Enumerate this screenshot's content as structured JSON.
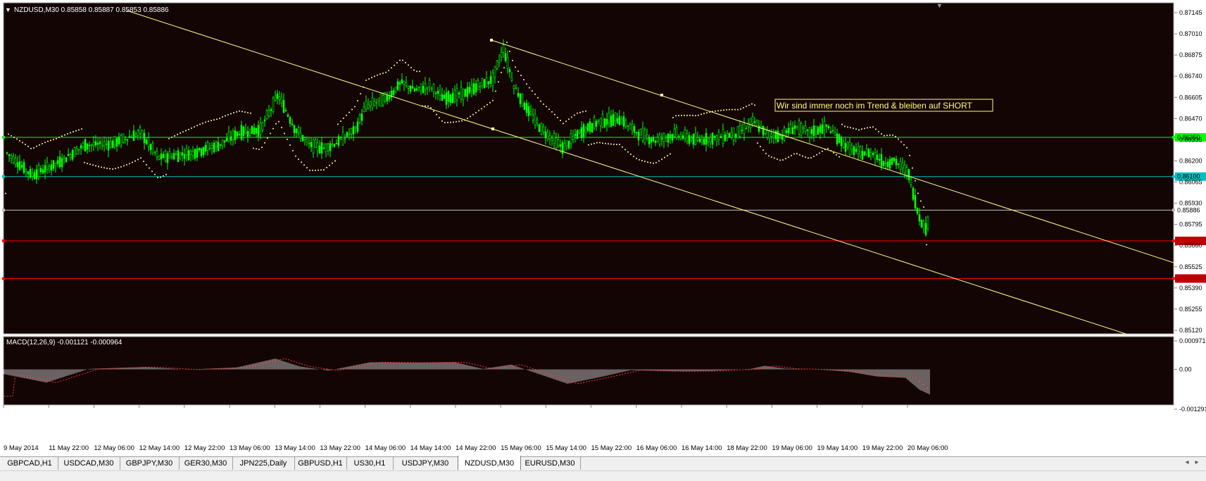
{
  "chart": {
    "header": "NZDUSD,M30  0.85858 0.85887 0.85853 0.85886",
    "annotation_text": "Wir sind immer noch im Trend &  bleiben auf SHORT",
    "macd_header": "MACD(12,26,9) -0.001121 -0.000964"
  },
  "chart_data": [
    {
      "type": "line",
      "title": "NZDUSD,M30",
      "ohlc": [
        0.85858,
        0.85887,
        0.85853,
        0.85886
      ],
      "y_ticks": [
        "0.87145",
        "0.87010",
        "0.86875",
        "0.86740",
        "0.86605",
        "0.86470",
        "0.86335",
        "0.86200",
        "0.86065",
        "0.85930",
        "0.85795",
        "0.85660",
        "0.85525",
        "0.85390",
        "0.85255",
        "0.85120"
      ],
      "ylim": [
        0.8512,
        0.87145
      ],
      "x_ticks": [
        "9 May 2014",
        "11 May 22:00",
        "12 May 06:00",
        "12 May 14:00",
        "12 May 22:00",
        "13 May 06:00",
        "13 May 14:00",
        "13 May 22:00",
        "14 May 06:00",
        "14 May 14:00",
        "14 May 22:00",
        "15 May 06:00",
        "15 May 14:00",
        "15 May 22:00",
        "16 May 06:00",
        "16 May 14:00",
        "18 May 22:00",
        "19 May 06:00",
        "19 May 14:00",
        "19 May 22:00",
        "20 May 06:00"
      ],
      "horizontal_levels": [
        {
          "label": "0.86350",
          "value": 0.8635,
          "color": "#00ff00"
        },
        {
          "label": "0.86100",
          "value": 0.861,
          "color": "#00c0c0"
        },
        {
          "label": "0.85886",
          "value": 0.85886,
          "color": "#c0c0c0"
        },
        {
          "label": "",
          "value": 0.8569,
          "color": "#ff0000"
        },
        {
          "label": "",
          "value": 0.8545,
          "color": "#ff0000"
        }
      ],
      "trend_channel": [
        {
          "from": [
            "9 May 2014",
            0.8714
          ],
          "to": [
            "20 May 06:00",
            0.8522
          ]
        },
        {
          "from": [
            "14 May 22:00",
            0.8702
          ],
          "to": [
            "20 May 06:00",
            0.8571
          ]
        }
      ],
      "colors": {
        "background": "#140505",
        "candles": "#00ff00",
        "sar": "#ffff99",
        "trendline": "#ffff80"
      }
    },
    {
      "type": "bar",
      "title": "MACD(12,26,9)",
      "values_shown": {
        "macd": -0.001121,
        "signal": -0.000964
      },
      "y_ticks": [
        "0.000971",
        "0.00",
        "-0.001291"
      ],
      "ylim": [
        -0.001291,
        0.000971
      ],
      "colors": {
        "histogram": "#c0c0c0",
        "signal": "#ff3030"
      }
    }
  ],
  "tabs": [
    {
      "label": "GBPCAD,H1"
    },
    {
      "label": "USDCAD,M30"
    },
    {
      "label": "GBPJPY,M30"
    },
    {
      "label": "GER30,M30"
    },
    {
      "label": "JPN225,Daily"
    },
    {
      "label": "GBPUSD,H1"
    },
    {
      "label": "US30,H1"
    },
    {
      "label": "USDJPY,M30"
    },
    {
      "label": "NZDUSD,M30",
      "active": true
    },
    {
      "label": "EURUSD,M30"
    }
  ],
  "icons": {
    "tabs_scroll_left": "arrow-left-icon",
    "tabs_scroll_right": "arrow-right-icon",
    "chart_menu": "triangle-down-icon",
    "shift_marker": "triangle-down-icon"
  }
}
